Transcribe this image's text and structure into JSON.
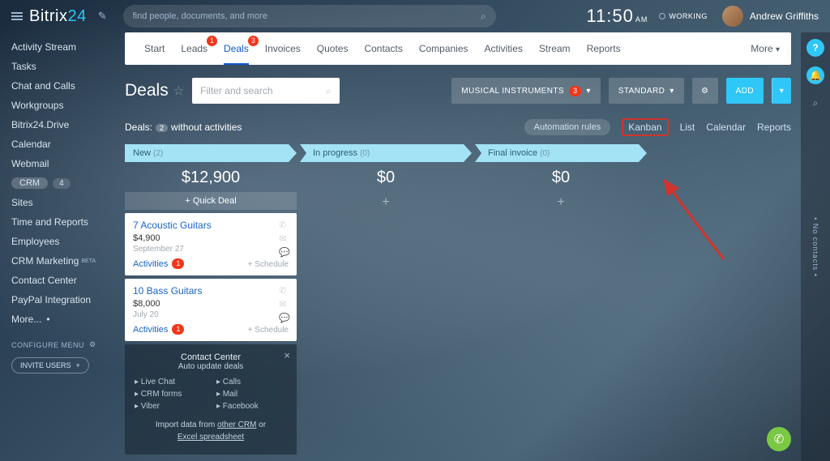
{
  "brand": {
    "a": "Bitrix",
    "b": "24"
  },
  "search_placeholder": "find people, documents, and more",
  "clock": {
    "time": "11:50",
    "ampm": "AM"
  },
  "working": "WORKING",
  "user": "Andrew Griffiths",
  "sidebar": [
    {
      "label": "Activity Stream"
    },
    {
      "label": "Tasks"
    },
    {
      "label": "Chat and Calls"
    },
    {
      "label": "Workgroups"
    },
    {
      "label": "Bitrix24.Drive"
    },
    {
      "label": "Calendar"
    },
    {
      "label": "Webmail"
    },
    {
      "label": "CRM",
      "crm": true,
      "badge": "4"
    },
    {
      "label": "Sites"
    },
    {
      "label": "Time and Reports"
    },
    {
      "label": "Employees"
    },
    {
      "label": "CRM Marketing",
      "beta": "BETA"
    },
    {
      "label": "Contact Center"
    },
    {
      "label": "PayPal Integration"
    },
    {
      "label": "More...",
      "dots": "•"
    }
  ],
  "configure": "CONFIGURE MENU",
  "invite": "INVITE USERS",
  "tabs": [
    {
      "label": "Start"
    },
    {
      "label": "Leads",
      "badge": "1"
    },
    {
      "label": "Deals",
      "badge": "3",
      "active": true
    },
    {
      "label": "Invoices"
    },
    {
      "label": "Quotes"
    },
    {
      "label": "Contacts"
    },
    {
      "label": "Companies"
    },
    {
      "label": "Activities"
    },
    {
      "label": "Stream"
    },
    {
      "label": "Reports"
    }
  ],
  "tabs_more": "More",
  "page_title": "Deals",
  "filter_placeholder": "Filter and search",
  "pipeline": {
    "label": "MUSICAL INSTRUMENTS",
    "badge": "3"
  },
  "viewbtn": "STANDARD",
  "add": "ADD",
  "sub": {
    "deals_label": "Deals:",
    "count": "2",
    "without": "without activities"
  },
  "views": {
    "auto": "Automation rules",
    "kanban": "Kanban",
    "list": "List",
    "calendar": "Calendar",
    "reports": "Reports"
  },
  "columns": [
    {
      "name": "New",
      "count": "(2)",
      "total": "$12,900",
      "quick": "+  Quick Deal"
    },
    {
      "name": "In progress",
      "count": "(0)",
      "total": "$0"
    },
    {
      "name": "Final invoice",
      "count": "(0)",
      "total": "$0"
    }
  ],
  "cards": [
    {
      "title": "7 Acoustic Guitars",
      "price": "$4,900",
      "date": "September 27",
      "act": "Activities",
      "ab": "1",
      "sched": "+ Schedule"
    },
    {
      "title": "10 Bass Guitars",
      "price": "$8,000",
      "date": "July 20",
      "act": "Activities",
      "ab": "1",
      "sched": "+ Schedule"
    }
  ],
  "cc": {
    "h1": "Contact Center",
    "h2": "Auto update deals",
    "items": [
      "Live Chat",
      "Calls",
      "CRM forms",
      "Mail",
      "Viber",
      "Facebook"
    ],
    "import1": "Import data from ",
    "importA": "other CRM",
    "or": " or",
    "importB": "Excel spreadsheet"
  },
  "rail": {
    "nocontacts": "• No contacts •"
  }
}
